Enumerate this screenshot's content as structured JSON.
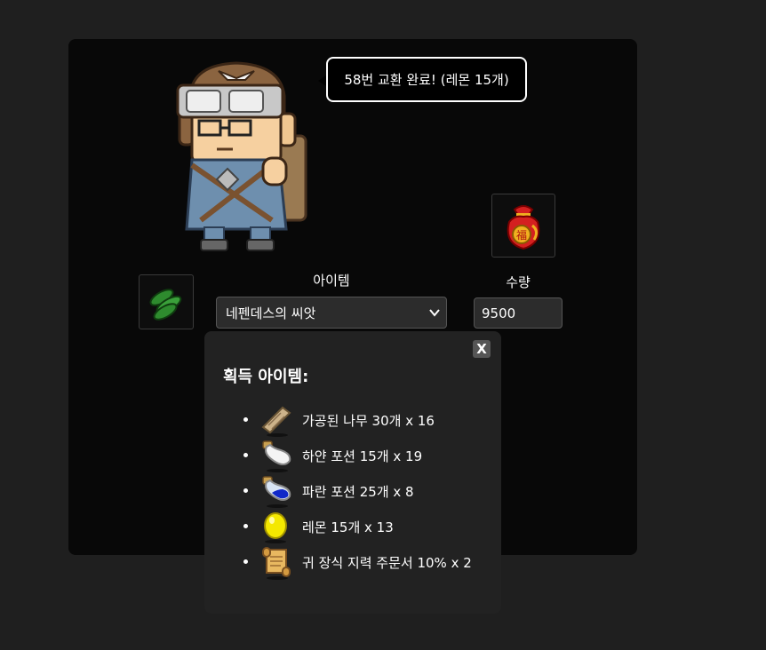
{
  "npc": {
    "speech": "58번 교환 완료! (레몬 15개)"
  },
  "exchange": {
    "item_label": "아이템",
    "qty_label": "수량",
    "selected_item": "네펜데스의 씨앗",
    "quantity": "9500",
    "reward_icon": "lucky-pouch-icon",
    "input_icon": "seed-icon"
  },
  "popup": {
    "close_label": "X",
    "title": "획득 아이템:",
    "items": [
      {
        "icon": "wood-plank-icon",
        "text": "가공된 나무 30개 x 16"
      },
      {
        "icon": "white-potion-icon",
        "text": "하얀 포션 15개 x 19"
      },
      {
        "icon": "blue-potion-icon",
        "text": "파란 포션 25개 x 8"
      },
      {
        "icon": "lemon-icon",
        "text": "레몬 15개 x 13"
      },
      {
        "icon": "scroll-icon",
        "text": "귀 장식 지력 주문서 10% x 2"
      }
    ]
  }
}
